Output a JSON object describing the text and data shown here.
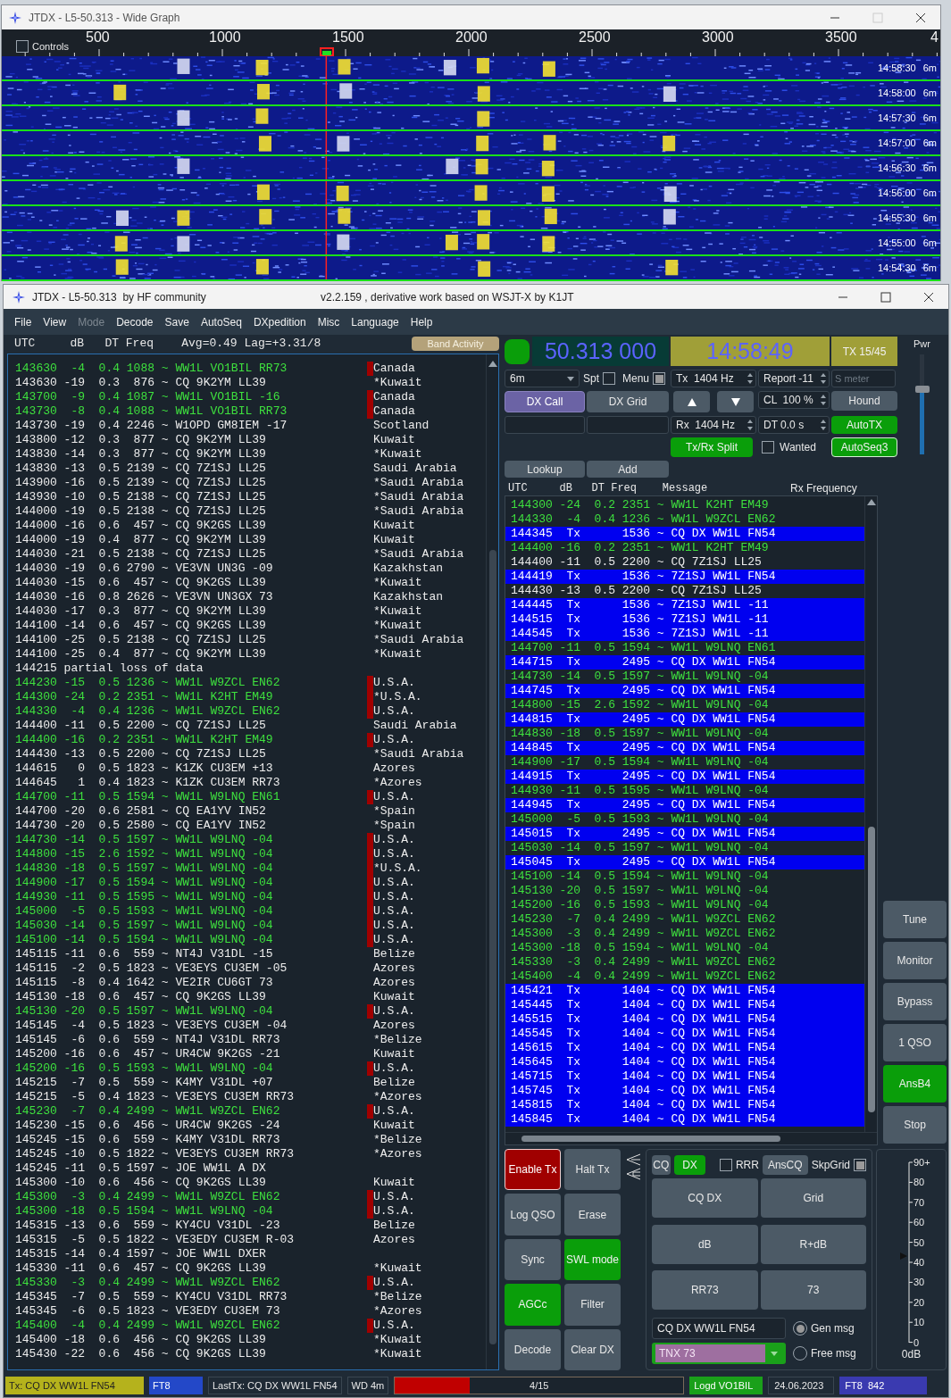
{
  "wide_graph": {
    "title": "JTDX - L5-50.313 - Wide Graph",
    "controls": {
      "label": "Controls",
      "checked": false
    },
    "scale": [
      "500",
      "1000",
      "1500",
      "2000",
      "2500",
      "3000",
      "3500",
      "4"
    ],
    "rows": [
      {
        "time": "14:58:30",
        "band": "6m"
      },
      {
        "time": "14:58:00",
        "band": "6m"
      },
      {
        "time": "14:57:30",
        "band": "6m"
      },
      {
        "time": "14:57:00",
        "band": "6m"
      },
      {
        "time": "14:56:30",
        "band": "6m"
      },
      {
        "time": "14:56:00",
        "band": "6m"
      },
      {
        "time": "14:55:30",
        "band": "6m"
      },
      {
        "time": "14:55:00",
        "band": "6m"
      },
      {
        "time": "14:54:30",
        "band": "6m"
      }
    ]
  },
  "main": {
    "title": "JTDX - L5-50.313  by HF community",
    "version": "v2.2.159 , derivative work based on WSJT-X by K1JT"
  },
  "menu": [
    {
      "label": "File",
      "disabled": false
    },
    {
      "label": "View",
      "disabled": false
    },
    {
      "label": "Mode",
      "disabled": true
    },
    {
      "label": "Decode",
      "disabled": false
    },
    {
      "label": "Save",
      "disabled": false
    },
    {
      "label": "AutoSeq",
      "disabled": false
    },
    {
      "label": "DXpedition",
      "disabled": false
    },
    {
      "label": "Misc",
      "disabled": false
    },
    {
      "label": "Language",
      "disabled": false
    },
    {
      "label": "Help",
      "disabled": false
    }
  ],
  "band_activity": {
    "header": "UTC     dB   DT Freq    Avg=0.49 Lag=+3.31/8",
    "button": "Band Activity",
    "rows": [
      {
        "text": "143630  -4  0.4 1088 ~ WW1L VO1BIL RR73",
        "country": "Canada",
        "kind": "to_me"
      },
      {
        "text": "143630 -19  0.3  876 ~ CQ 9K2YM LL39",
        "country": "*Kuwait",
        "kind": "other"
      },
      {
        "text": "143700  -9  0.4 1087 ~ WW1L VO1BIL -16",
        "country": "Canada",
        "kind": "to_me"
      },
      {
        "text": "143730  -8  0.4 1088 ~ WW1L VO1BIL RR73",
        "country": "Canada",
        "kind": "to_me"
      },
      {
        "text": "143730 -19  0.4 2246 ~ W1OPD GM8IEM -17",
        "country": "Scotland",
        "kind": "other"
      },
      {
        "text": "143800 -12  0.3  877 ~ CQ 9K2YM LL39",
        "country": "Kuwait",
        "kind": "other"
      },
      {
        "text": "143830 -14  0.3  877 ~ CQ 9K2YM LL39",
        "country": "*Kuwait",
        "kind": "other"
      },
      {
        "text": "143830 -13  0.5 2139 ~ CQ 7Z1SJ LL25",
        "country": "Saudi Arabia",
        "kind": "other"
      },
      {
        "text": "143900 -16  0.5 2139 ~ CQ 7Z1SJ LL25",
        "country": "*Saudi Arabia",
        "kind": "other"
      },
      {
        "text": "143930 -10  0.5 2138 ~ CQ 7Z1SJ LL25",
        "country": "*Saudi Arabia",
        "kind": "other"
      },
      {
        "text": "144000 -19  0.5 2138 ~ CQ 7Z1SJ LL25",
        "country": "*Saudi Arabia",
        "kind": "other"
      },
      {
        "text": "144000 -16  0.6  457 ~ CQ 9K2GS LL39",
        "country": "Kuwait",
        "kind": "other"
      },
      {
        "text": "144000 -19  0.4  877 ~ CQ 9K2YM LL39",
        "country": "Kuwait",
        "kind": "other"
      },
      {
        "text": "144030 -21  0.5 2138 ~ CQ 7Z1SJ LL25",
        "country": "*Saudi Arabia",
        "kind": "other"
      },
      {
        "text": "144030 -19  0.6 2790 ~ VE3VN UN3G -09",
        "country": "Kazakhstan",
        "kind": "other"
      },
      {
        "text": "144030 -15  0.6  457 ~ CQ 9K2GS LL39",
        "country": "*Kuwait",
        "kind": "other"
      },
      {
        "text": "144030 -16  0.8 2626 ~ VE3VN UN3GX 73",
        "country": "Kazakhstan",
        "kind": "other"
      },
      {
        "text": "144030 -17  0.3  877 ~ CQ 9K2YM LL39",
        "country": "*Kuwait",
        "kind": "other"
      },
      {
        "text": "144100 -14  0.6  457 ~ CQ 9K2GS LL39",
        "country": "*Kuwait",
        "kind": "other"
      },
      {
        "text": "144100 -25  0.5 2138 ~ CQ 7Z1SJ LL25",
        "country": "*Saudi Arabia",
        "kind": "other"
      },
      {
        "text": "144100 -25  0.4  877 ~ CQ 9K2YM LL39",
        "country": "*Kuwait",
        "kind": "other"
      },
      {
        "text": "144215 partial loss of data",
        "kind": "other"
      },
      {
        "text": "144230 -15  0.5 1236 ~ WW1L W9ZCL EN62",
        "country": "U.S.A.",
        "kind": "to_me"
      },
      {
        "text": "144300 -24  0.2 2351 ~ WW1L K2HT EM49",
        "country": "*U.S.A.",
        "kind": "to_me"
      },
      {
        "text": "144330  -4  0.4 1236 ~ WW1L W9ZCL EN62",
        "country": "U.S.A.",
        "kind": "to_me"
      },
      {
        "text": "144400 -11  0.5 2200 ~ CQ 7Z1SJ LL25",
        "country": "Saudi Arabia",
        "kind": "other"
      },
      {
        "text": "144400 -16  0.2 2351 ~ WW1L K2HT EM49",
        "country": "U.S.A.",
        "kind": "to_me"
      },
      {
        "text": "144430 -13  0.5 2200 ~ CQ 7Z1SJ LL25",
        "country": "*Saudi Arabia",
        "kind": "other"
      },
      {
        "text": "144615   0  0.5 1823 ~ K1ZK CU3EM +13",
        "country": "Azores",
        "kind": "other"
      },
      {
        "text": "144645   1  0.4 1823 ~ K1ZK CU3EM RR73",
        "country": "*Azores",
        "kind": "other"
      },
      {
        "text": "144700 -11  0.5 1594 ~ WW1L W9LNQ EN61",
        "country": "U.S.A.",
        "kind": "to_me"
      },
      {
        "text": "144700 -20  0.6 2581 ~ CQ EA1YV IN52",
        "country": "*Spain",
        "kind": "other"
      },
      {
        "text": "144730 -20  0.5 2580 ~ CQ EA1YV IN52",
        "country": "*Spain",
        "kind": "other"
      },
      {
        "text": "144730 -14  0.5 1597 ~ WW1L W9LNQ -04",
        "country": "U.S.A.",
        "kind": "to_me"
      },
      {
        "text": "144800 -15  2.6 1592 ~ WW1L W9LNQ -04",
        "country": "U.S.A.",
        "kind": "to_me"
      },
      {
        "text": "144830 -18  0.5 1597 ~ WW1L W9LNQ -04",
        "country": "*U.S.A.",
        "kind": "to_me"
      },
      {
        "text": "144900 -17  0.5 1594 ~ WW1L W9LNQ -04",
        "country": "U.S.A.",
        "kind": "to_me"
      },
      {
        "text": "144930 -11  0.5 1595 ~ WW1L W9LNQ -04",
        "country": "U.S.A.",
        "kind": "to_me"
      },
      {
        "text": "145000  -5  0.5 1593 ~ WW1L W9LNQ -04",
        "country": "U.S.A.",
        "kind": "to_me"
      },
      {
        "text": "145030 -14  0.5 1597 ~ WW1L W9LNQ -04",
        "country": "U.S.A.",
        "kind": "to_me"
      },
      {
        "text": "145100 -14  0.5 1594 ~ WW1L W9LNQ -04",
        "country": "U.S.A.",
        "kind": "to_me"
      },
      {
        "text": "145115 -11  0.6  559 ~ NT4J V31DL -15",
        "country": "Belize",
        "kind": "other"
      },
      {
        "text": "145115  -2  0.5 1823 ~ VE3EYS CU3EM -05",
        "country": "Azores",
        "kind": "other"
      },
      {
        "text": "145115  -8  0.4 1642 ~ VE2IR CU6GT 73",
        "country": "Azores",
        "kind": "other"
      },
      {
        "text": "145130 -18  0.6  457 ~ CQ 9K2GS LL39",
        "country": "Kuwait",
        "kind": "other"
      },
      {
        "text": "145130 -20  0.5 1597 ~ WW1L W9LNQ -04",
        "country": "U.S.A.",
        "kind": "to_me"
      },
      {
        "text": "145145  -4  0.5 1823 ~ VE3EYS CU3EM -04",
        "country": "Azores",
        "kind": "other"
      },
      {
        "text": "145145  -6  0.6  559 ~ NT4J V31DL RR73",
        "country": "*Belize",
        "kind": "other"
      },
      {
        "text": "145200 -16  0.6  457 ~ UR4CW 9K2GS -21",
        "country": "Kuwait",
        "kind": "other"
      },
      {
        "text": "145200 -16  0.5 1593 ~ WW1L W9LNQ -04",
        "country": "U.S.A.",
        "kind": "to_me"
      },
      {
        "text": "145215  -7  0.5  559 ~ K4MY V31DL +07",
        "country": "Belize",
        "kind": "other"
      },
      {
        "text": "145215  -5  0.4 1823 ~ VE3EYS CU3EM RR73",
        "country": "*Azores",
        "kind": "other"
      },
      {
        "text": "145230  -7  0.4 2499 ~ WW1L W9ZCL EN62",
        "country": "U.S.A.",
        "kind": "to_me"
      },
      {
        "text": "145230 -15  0.6  456 ~ UR4CW 9K2GS -24",
        "country": "Kuwait",
        "kind": "other"
      },
      {
        "text": "145245 -15  0.6  559 ~ K4MY V31DL RR73",
        "country": "*Belize",
        "kind": "other"
      },
      {
        "text": "145245 -10  0.5 1822 ~ VE3EYS CU3EM RR73",
        "country": "*Azores",
        "kind": "other"
      },
      {
        "text": "145245 -11  0.5 1597 ~ JOE WW1L A DX",
        "kind": "other"
      },
      {
        "text": "145300 -10  0.6  456 ~ CQ 9K2GS LL39",
        "country": "Kuwait",
        "kind": "other"
      },
      {
        "text": "145300  -3  0.4 2499 ~ WW1L W9ZCL EN62",
        "country": "U.S.A.",
        "kind": "to_me"
      },
      {
        "text": "145300 -18  0.5 1594 ~ WW1L W9LNQ -04",
        "country": "U.S.A.",
        "kind": "to_me"
      },
      {
        "text": "145315 -13  0.6  559 ~ KY4CU V31DL -23",
        "country": "Belize",
        "kind": "other"
      },
      {
        "text": "145315  -5  0.5 1822 ~ VE3EDY CU3EM R-03",
        "country": "Azores",
        "kind": "other"
      },
      {
        "text": "145315 -14  0.4 1597 ~ JOE WW1L DXER",
        "kind": "other"
      },
      {
        "text": "145330 -11  0.6  457 ~ CQ 9K2GS LL39",
        "country": "*Kuwait",
        "kind": "other"
      },
      {
        "text": "145330  -3  0.4 2499 ~ WW1L W9ZCL EN62",
        "country": "U.S.A.",
        "kind": "to_me"
      },
      {
        "text": "145345  -7  0.5  559 ~ KY4CU V31DL RR73",
        "country": "*Belize",
        "kind": "other"
      },
      {
        "text": "145345  -6  0.5 1823 ~ VE3EDY CU3EM 73",
        "country": "*Azores",
        "kind": "other"
      },
      {
        "text": "145400  -4  0.4 2499 ~ WW1L W9ZCL EN62",
        "country": "U.S.A.",
        "kind": "to_me"
      },
      {
        "text": "145400 -18  0.6  456 ~ CQ 9K2GS LL39",
        "country": "*Kuwait",
        "kind": "other"
      },
      {
        "text": "145430 -22  0.6  456 ~ CQ 9K2GS LL39",
        "country": "*Kuwait",
        "kind": "other"
      }
    ]
  },
  "controls": {
    "led_on": true,
    "frequency": "50.313 000",
    "time": "14:58:49",
    "tx_period": "TX 15/45",
    "band": "6m",
    "spt": {
      "label": "Spt",
      "checked": false
    },
    "menu_toggle": {
      "label": "Menu",
      "checked": true
    },
    "tx_freq": "Tx  1404 Hz",
    "report": "Report -11",
    "s_meter_placeholder": "S meter",
    "dx_call": "DX Call",
    "dx_grid": "DX Grid",
    "cl": "CL  100 %",
    "hound": {
      "label": "Hound",
      "on": false
    },
    "rx_freq": "Rx  1404 Hz",
    "dt": "DT 0.0 s",
    "auto_tx": {
      "label": "AutoTX",
      "on": true
    },
    "split": {
      "label": "Tx/Rx Split",
      "on": true
    },
    "wanted": {
      "label": "Wanted",
      "checked": false
    },
    "auto_seq": {
      "label": "AutoSeq3",
      "on": true
    },
    "lookup": "Lookup",
    "add": "Add",
    "pwr": {
      "label": "Pwr",
      "level": 0.65
    }
  },
  "rx_frequency": {
    "header": "UTC     dB   DT Freq    Message",
    "title": "Rx Frequency",
    "rows": [
      {
        "text": "144300 -24  0.2 2351 ~ WW1L K2HT EM49",
        "kind": "to_me"
      },
      {
        "text": "144330  -4  0.4 1236 ~ WW1L W9ZCL EN62",
        "kind": "to_me"
      },
      {
        "text": "144345  Tx      1536 ~ CQ DX WW1L FN54",
        "kind": "tx"
      },
      {
        "text": "144400 -16  0.2 2351 ~ WW1L K2HT EM49",
        "kind": "to_me"
      },
      {
        "text": "144400 -11  0.5 2200 ~ CQ 7Z1SJ LL25",
        "kind": "other"
      },
      {
        "text": "144419  Tx      1536 ~ 7Z1SJ WW1L FN54",
        "kind": "tx"
      },
      {
        "text": "144430 -13  0.5 2200 ~ CQ 7Z1SJ LL25",
        "kind": "other"
      },
      {
        "text": "144445  Tx      1536 ~ 7Z1SJ WW1L -11",
        "kind": "tx"
      },
      {
        "text": "144515  Tx      1536 ~ 7Z1SJ WW1L -11",
        "kind": "tx"
      },
      {
        "text": "144545  Tx      1536 ~ 7Z1SJ WW1L -11",
        "kind": "tx"
      },
      {
        "text": "144700 -11  0.5 1594 ~ WW1L W9LNQ EN61",
        "kind": "to_me"
      },
      {
        "text": "144715  Tx      2495 ~ CQ DX WW1L FN54",
        "kind": "tx"
      },
      {
        "text": "144730 -14  0.5 1597 ~ WW1L W9LNQ -04",
        "kind": "to_me"
      },
      {
        "text": "144745  Tx      2495 ~ CQ DX WW1L FN54",
        "kind": "tx"
      },
      {
        "text": "144800 -15  2.6 1592 ~ WW1L W9LNQ -04",
        "kind": "to_me"
      },
      {
        "text": "144815  Tx      2495 ~ CQ DX WW1L FN54",
        "kind": "tx"
      },
      {
        "text": "144830 -18  0.5 1597 ~ WW1L W9LNQ -04",
        "kind": "to_me"
      },
      {
        "text": "144845  Tx      2495 ~ CQ DX WW1L FN54",
        "kind": "tx"
      },
      {
        "text": "144900 -17  0.5 1594 ~ WW1L W9LNQ -04",
        "kind": "to_me"
      },
      {
        "text": "144915  Tx      2495 ~ CQ DX WW1L FN54",
        "kind": "tx"
      },
      {
        "text": "144930 -11  0.5 1595 ~ WW1L W9LNQ -04",
        "kind": "to_me"
      },
      {
        "text": "144945  Tx      2495 ~ CQ DX WW1L FN54",
        "kind": "tx"
      },
      {
        "text": "145000  -5  0.5 1593 ~ WW1L W9LNQ -04",
        "kind": "to_me"
      },
      {
        "text": "145015  Tx      2495 ~ CQ DX WW1L FN54",
        "kind": "tx"
      },
      {
        "text": "145030 -14  0.5 1597 ~ WW1L W9LNQ -04",
        "kind": "to_me"
      },
      {
        "text": "145045  Tx      2495 ~ CQ DX WW1L FN54",
        "kind": "tx"
      },
      {
        "text": "145100 -14  0.5 1594 ~ WW1L W9LNQ -04",
        "kind": "to_me"
      },
      {
        "text": "145130 -20  0.5 1597 ~ WW1L W9LNQ -04",
        "kind": "to_me"
      },
      {
        "text": "145200 -16  0.5 1593 ~ WW1L W9LNQ -04",
        "kind": "to_me"
      },
      {
        "text": "145230  -7  0.4 2499 ~ WW1L W9ZCL EN62",
        "kind": "to_me"
      },
      {
        "text": "145300  -3  0.4 2499 ~ WW1L W9ZCL EN62",
        "kind": "to_me"
      },
      {
        "text": "145300 -18  0.5 1594 ~ WW1L W9LNQ -04",
        "kind": "to_me"
      },
      {
        "text": "145330  -3  0.4 2499 ~ WW1L W9ZCL EN62",
        "kind": "to_me"
      },
      {
        "text": "145400  -4  0.4 2499 ~ WW1L W9ZCL EN62",
        "kind": "to_me"
      },
      {
        "text": "145421  Tx      1404 ~ CQ DX WW1L FN54",
        "kind": "tx"
      },
      {
        "text": "145445  Tx      1404 ~ CQ DX WW1L FN54",
        "kind": "tx"
      },
      {
        "text": "145515  Tx      1404 ~ CQ DX WW1L FN54",
        "kind": "tx"
      },
      {
        "text": "145545  Tx      1404 ~ CQ DX WW1L FN54",
        "kind": "tx"
      },
      {
        "text": "145615  Tx      1404 ~ CQ DX WW1L FN54",
        "kind": "tx"
      },
      {
        "text": "145645  Tx      1404 ~ CQ DX WW1L FN54",
        "kind": "tx"
      },
      {
        "text": "145715  Tx      1404 ~ CQ DX WW1L FN54",
        "kind": "tx"
      },
      {
        "text": "145745  Tx      1404 ~ CQ DX WW1L FN54",
        "kind": "tx"
      },
      {
        "text": "145815  Tx      1404 ~ CQ DX WW1L FN54",
        "kind": "tx"
      },
      {
        "text": "145845  Tx      1404 ~ CQ DX WW1L FN54",
        "kind": "tx"
      }
    ]
  },
  "side_buttons": [
    {
      "label": "Tune",
      "on": false
    },
    {
      "label": "Monitor",
      "on": false
    },
    {
      "label": "Bypass",
      "on": false
    },
    {
      "label": "1 QSO",
      "on": false
    },
    {
      "label": "AnsB4",
      "on": true
    },
    {
      "label": "Stop",
      "on": false
    }
  ],
  "enable_tx": {
    "label": "Enable Tx",
    "on": true
  },
  "bottom_buttons": [
    {
      "label": "Halt Tx",
      "on": false
    },
    {
      "label": "Log QSO",
      "on": false
    },
    {
      "label": "Erase",
      "on": false
    },
    {
      "label": "Sync",
      "on": false
    },
    {
      "label": "SWL mode",
      "on": true
    },
    {
      "label": "AGCc",
      "on": true
    },
    {
      "label": "Filter",
      "on": false
    },
    {
      "label": "Decode",
      "on": false
    },
    {
      "label": "Clear DX",
      "on": false
    }
  ],
  "message_panel": {
    "modes": [
      {
        "label": "CQ",
        "on": false
      },
      {
        "label": "DX",
        "on": true
      }
    ],
    "rrr": {
      "label": "RRR",
      "checked": false
    },
    "ans_cq": "AnsCQ",
    "skip_grid": {
      "label": "SkpGrid",
      "checked": true
    },
    "messages": [
      "CQ DX",
      "Grid",
      "dB",
      "R+dB",
      "RR73",
      "73"
    ],
    "gen_field": "CQ DX WW1L FN54",
    "free_combo": "TNX 73",
    "radios": [
      {
        "label": "Gen msg",
        "selected": true
      },
      {
        "label": "Free msg",
        "selected": false
      }
    ]
  },
  "meter": {
    "ticks": [
      "90+",
      "80",
      "70",
      "60",
      "50",
      "40",
      "30",
      "20",
      "10",
      "0"
    ],
    "unit": "0dB",
    "level": 0.48
  },
  "status_bar": {
    "tx": "Tx: CQ DX WW1L FN54",
    "mode": "FT8",
    "last_tx": "LastTx: CQ DX WW1L FN54",
    "wd": "WD 4m",
    "progress": {
      "label": "4/15",
      "level": 0.26
    },
    "logged": "Logd VO1BIL",
    "date": "24.06.2023",
    "counter": "FT8  842"
  }
}
